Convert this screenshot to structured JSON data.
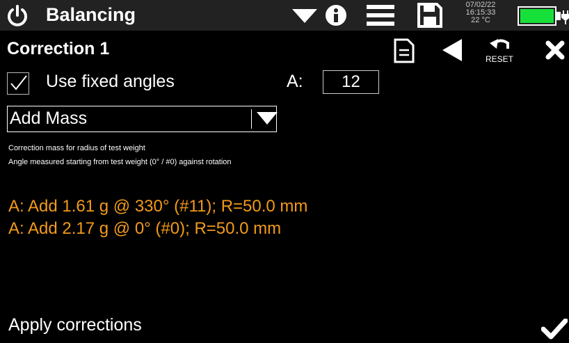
{
  "header": {
    "title": "Balancing",
    "date": "07/02/22",
    "time": "16:15:33",
    "temperature": "22 °C",
    "battery_color": "#18e03a",
    "icons": [
      "power-icon",
      "dropdown-icon",
      "info-icon",
      "menu-icon",
      "save-icon",
      "battery-icon"
    ]
  },
  "toolbar": {
    "title": "Correction 1",
    "reset_label": "RESET",
    "icons": [
      "document-icon",
      "back-icon",
      "reset-icon",
      "close-icon"
    ]
  },
  "settings": {
    "fixed_angles_label": "Use fixed angles",
    "fixed_angles_checked": true,
    "a_label": "A:",
    "a_value": "12",
    "mode_selected": "Add Mass"
  },
  "notes": {
    "line1": "Correction mass for radius of test weight",
    "line2": "Angle measured starting from test weight (0° / #0) against rotation"
  },
  "results": {
    "color": "#f39a1b",
    "line1": "A: Add 1.61 g @ 330° (#11); R=50.0 mm",
    "line2": "A: Add 2.17 g @ 0° (#0); R=50.0 mm"
  },
  "footer": {
    "apply_label": "Apply corrections",
    "confirm_icon": "checkmark-icon"
  }
}
